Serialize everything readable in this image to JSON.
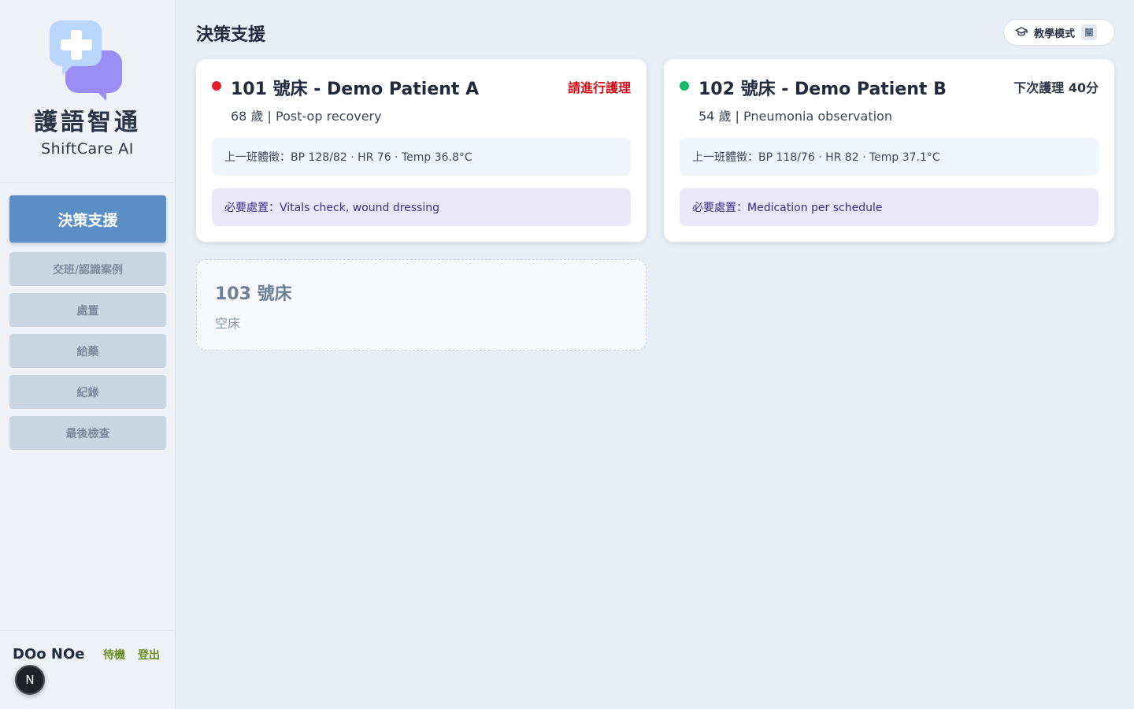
{
  "sidebar": {
    "logo_title": "護語智通",
    "logo_subtitle": "ShiftCare AI",
    "nav_items": [
      {
        "label": "決策支援",
        "active": true
      },
      {
        "label": "交班/認識案例",
        "active": false
      },
      {
        "label": "處置",
        "active": false
      },
      {
        "label": "給藥",
        "active": false
      },
      {
        "label": "紀錄",
        "active": false
      },
      {
        "label": "最後檢查",
        "active": false
      }
    ],
    "user_name": "DOo NOe",
    "standby_label": "待機",
    "logout_label": "登出",
    "avatar_letter": "N"
  },
  "header": {
    "title": "決策支援",
    "teach_mode_label": "教學模式",
    "teach_mode_state": "關",
    "teach_mode_icon": "graduation-cap-icon"
  },
  "beds": [
    {
      "title": "101 號床 - Demo Patient A",
      "subtitle": "68 歲 | Post-op recovery",
      "status_text": "請進行護理",
      "status_color": "#e0202a",
      "status_text_color": "#d10f1a",
      "vitals": "上一班體徵：BP 128/82 · HR 76 · Temp 36.8°C",
      "procedures": "必要處置：Vitals check, wound dressing"
    },
    {
      "title": "102 號床 - Demo Patient B",
      "subtitle": "54 歲 | Pneumonia observation",
      "status_text": "下次護理 40分",
      "status_color": "#14b86a",
      "status_text_color": "#2b3548",
      "vitals": "上一班體徵：BP 118/76 · HR 82 · Temp 37.1°C",
      "procedures": "必要處置：Medication per schedule"
    },
    {
      "title": "103 號床",
      "subtitle": "空床"
    }
  ],
  "colors": {
    "accent": "#5b8ec4",
    "link_green": "#6b8e23"
  }
}
